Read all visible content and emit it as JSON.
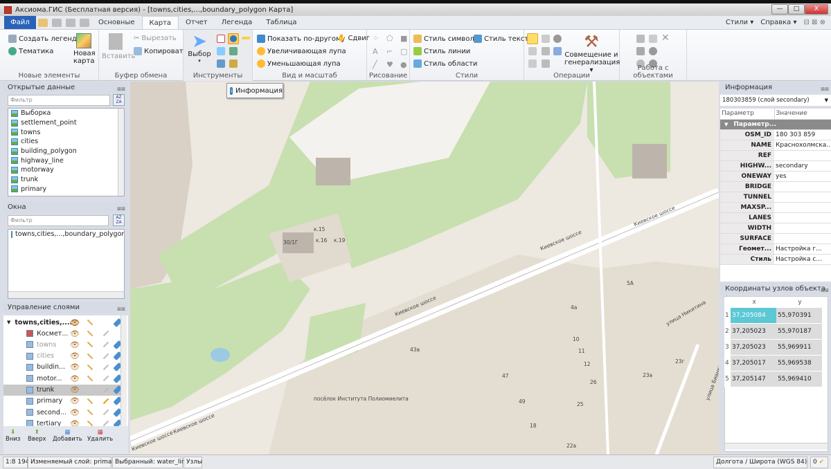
{
  "window": {
    "title": "Аксиома.ГИС (Бесплатная версия) - [towns,cities,...,boundary_polygon Карта]",
    "minimize": "—",
    "maximize": "□",
    "close": "X"
  },
  "ribbon_tabs": {
    "file": "Файл",
    "tabs": [
      "Основные",
      "Карта",
      "Отчет",
      "Легенда",
      "Таблица"
    ],
    "active": "Карта",
    "right": [
      "Стили ▾",
      "Справка ▾"
    ]
  },
  "ribbon": {
    "new_elements": {
      "label": "Новые элементы",
      "create_legend": "Создать легенду",
      "thematic": "Тематика",
      "new_map": "Новая карта"
    },
    "clipboard": {
      "label": "Буфер обмена",
      "paste": "Вставить",
      "cut": "Вырезать",
      "copy": "Копировать"
    },
    "tools": {
      "label": "Инструменты",
      "select": "Выбор"
    },
    "view": {
      "label": "Вид и масштаб",
      "show_other": "Показать по-другому",
      "pan": "Сдвиг",
      "zoom_in": "Увеличивающая лупа",
      "zoom_out": "Уменьшающая лупа"
    },
    "drawing": {
      "label": "Рисование"
    },
    "styles": {
      "label": "Стили",
      "symbol": "Стиль символа",
      "text": "Стиль текста",
      "line": "Стиль линии",
      "area": "Стиль области"
    },
    "operations": {
      "label": "Операции",
      "combine": "Совмещение и",
      "generalize": "генерализация ▾"
    },
    "objects": {
      "label": "Работа с объектами"
    }
  },
  "open_data": {
    "title": "Открытые данные",
    "filter_placeholder": "Фильтр",
    "items": [
      "Выборка",
      "settlement_point",
      "towns",
      "cities",
      "building_polygon",
      "highway_line",
      "motorway",
      "trunk",
      "primary"
    ]
  },
  "windows": {
    "title": "Окна",
    "filter_placeholder": "Фильтр",
    "items": [
      "towns,cities,...,boundary_polygon Карта"
    ]
  },
  "layers": {
    "title": "Управление слоями",
    "root": "towns,cities,....",
    "items": [
      "Космет...",
      "towns",
      "cities",
      "buildin...",
      "motor...",
      "trunk",
      "primary",
      "second...",
      "tertiary"
    ],
    "selected": "trunk",
    "buttons": [
      "Вниз",
      "Вверх",
      "Добавить",
      "Удалить"
    ]
  },
  "tooltip": "Информация",
  "map": {
    "labels": [
      "Киевское шоссе",
      "Киевское шоссе",
      "Киевское шоссе",
      "Киевское шоссе",
      "Киевское шоссе",
      "посёлок Института Полиомиелита",
      "улица Никитина",
      "улица Бианки",
      "30/1Г",
      "к.15",
      "к.16",
      "к.19",
      "43а",
      "5А",
      "4а",
      "10",
      "11",
      "12",
      "26",
      "25",
      "47",
      "49",
      "18",
      "23а",
      "23г",
      "22а"
    ]
  },
  "info": {
    "title": "Информация",
    "selector": "180303859 (слой secondary)",
    "col_param": "Параметр",
    "col_value": "Значение",
    "group": "Параметр...",
    "rows": [
      [
        "OSM_ID",
        "180 303 859"
      ],
      [
        "NAME",
        "Краснохолмска..."
      ],
      [
        "REF",
        ""
      ],
      [
        "HIGHW...",
        "secondary"
      ],
      [
        "ONEWAY",
        "yes"
      ],
      [
        "BRIDGE",
        ""
      ],
      [
        "TUNNEL",
        ""
      ],
      [
        "MAXSP...",
        ""
      ],
      [
        "LANES",
        ""
      ],
      [
        "WIDTH",
        ""
      ],
      [
        "SURFACE",
        ""
      ],
      [
        "Геомет...",
        "Настройка г..."
      ],
      [
        "Стиль",
        "Настройка с..."
      ]
    ]
  },
  "coords": {
    "title": "Координаты узлов объекта (гр...",
    "col_x": "x",
    "col_y": "y",
    "rows": [
      [
        "1",
        "37,205084",
        "55,970391"
      ],
      [
        "2",
        "37,205023",
        "55,970187"
      ],
      [
        "3",
        "37,205023",
        "55,969911"
      ],
      [
        "4",
        "37,205017",
        "55,969538"
      ],
      [
        "5",
        "37,205147",
        "55,969410"
      ]
    ]
  },
  "status": {
    "scale": "1:8 194",
    "editable": "Изменяемый слой: primary",
    "selected": "Выбранный: water_line",
    "nodes": "Узлы",
    "crs": "Долгота / Широта (WGS 84)",
    "count": "0"
  },
  "colors": {
    "accent": "#2a62b8",
    "highlight": "#5bc8d4",
    "map_bg": "#ede8e0",
    "park": "#c8dfb0",
    "building": "#d4cdc3"
  }
}
